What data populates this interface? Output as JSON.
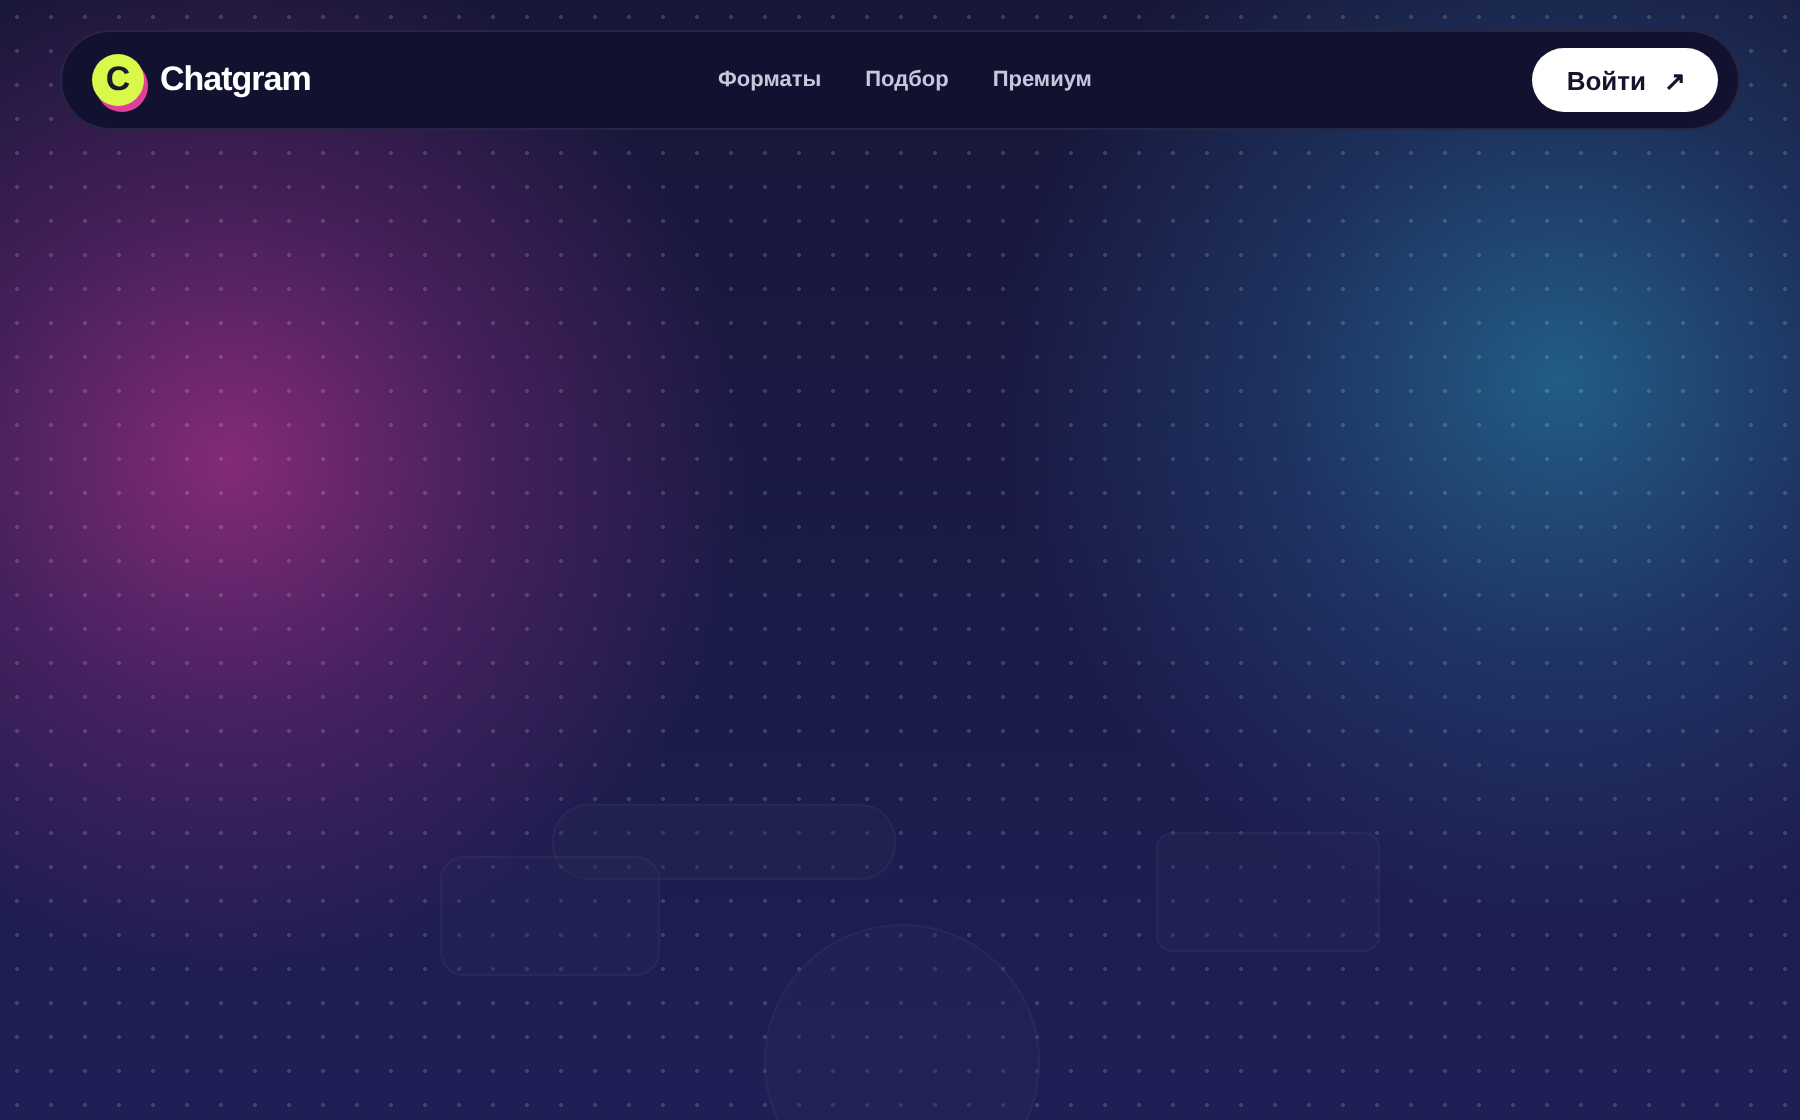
{
  "header": {
    "logo": {
      "letter": "C",
      "name": "Chatgram"
    },
    "nav": [
      {
        "label": "Форматы"
      },
      {
        "label": "Подбор"
      },
      {
        "label": "Премиум"
      }
    ],
    "login": {
      "label": "Войти",
      "arrow": "↗"
    }
  }
}
